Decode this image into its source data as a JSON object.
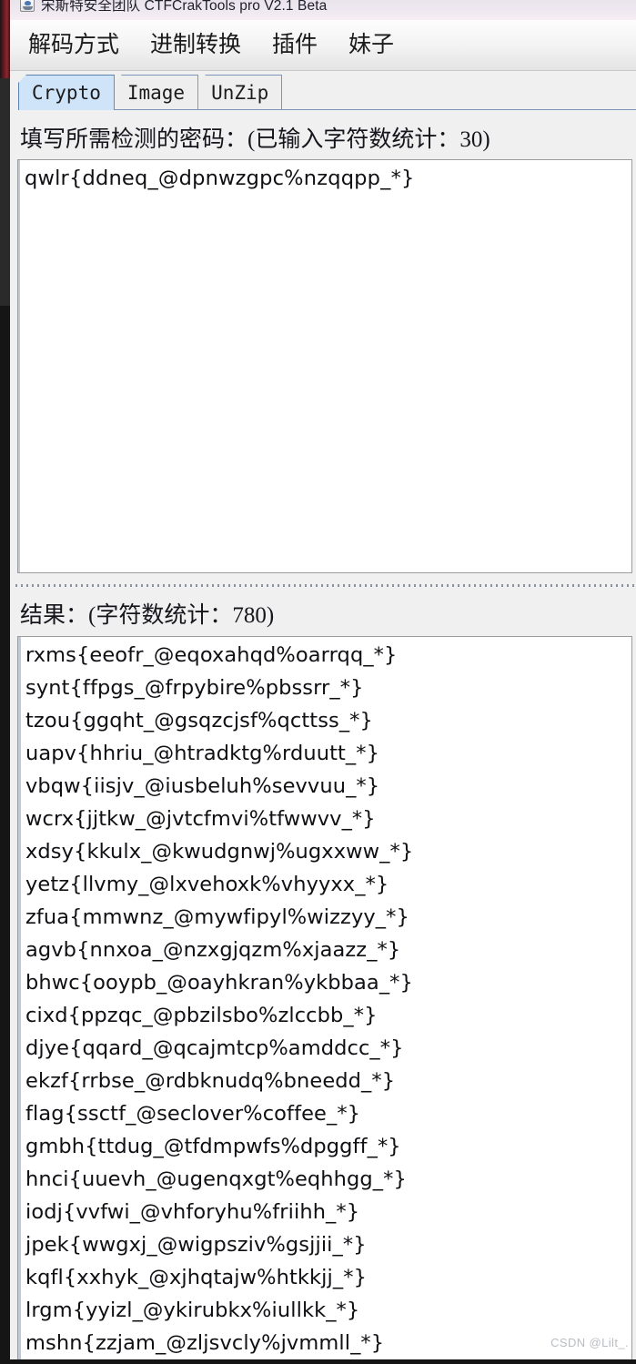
{
  "window": {
    "title": "宋斯特安全团队 CTFCrakTools pro V2.1 Beta",
    "icon": "java-app-icon"
  },
  "menubar": {
    "items": [
      {
        "label": "解码方式",
        "name": "menu-decode-method"
      },
      {
        "label": "进制转换",
        "name": "menu-base-convert"
      },
      {
        "label": "插件",
        "name": "menu-plugins"
      },
      {
        "label": "妹子",
        "name": "menu-girls"
      }
    ]
  },
  "tabs": {
    "selected": "Crypto",
    "items": [
      {
        "label": "Crypto"
      },
      {
        "label": "Image"
      },
      {
        "label": "UnZip"
      }
    ]
  },
  "input_panel": {
    "label": "填写所需检测的密码：(已输入字符数统计：30)",
    "char_count": "30",
    "value": "qwlr{ddneq_@dpnwzgpc%nzqqpp_*}"
  },
  "result_panel": {
    "label": "结果：(字符数统计：780)",
    "char_count": "780",
    "lines": [
      "rxms{eeofr_@eqoxahqd%oarrqq_*}",
      "synt{ffpgs_@frpybire%pbssrr_*}",
      "tzou{ggqht_@gsqzcjsf%qcttss_*}",
      "uapv{hhriu_@htradktg%rduutt_*}",
      "vbqw{iisjv_@iusbeluh%sevvuu_*}",
      "wcrx{jjtkw_@jvtcfmvi%tfwwvv_*}",
      "xdsy{kkulx_@kwudgnwj%ugxxww_*}",
      "yetz{llvmy_@lxvehoxk%vhyyxx_*}",
      "zfua{mmwnz_@mywfipyl%wizzyy_*}",
      "agvb{nnxoa_@nzxgjqzm%xjaazz_*}",
      "bhwc{ooypb_@oayhkran%ykbbaa_*}",
      "cixd{ppzqc_@pbzilsbo%zlccbb_*}",
      "djye{qqard_@qcajmtcp%amddcc_*}",
      "ekzf{rrbse_@rdbknudq%bneedd_*}",
      "flag{ssctf_@seclover%coffee_*}",
      "gmbh{ttdug_@tfdmpwfs%dpggff_*}",
      "hnci{uuevh_@ugenqxgt%eqhhgg_*}",
      "iodj{vvfwi_@vhforyhu%friihh_*}",
      "jpek{wwgxj_@wigpsziv%gsjjii_*}",
      "kqfl{xxhyk_@xjhqtajw%htkkjj_*}",
      "lrgm{yyizl_@ykirubkx%iullkk_*}",
      "mshn{zzjam_@zljsvcly%jvmmll_*}"
    ]
  },
  "watermark": {
    "text": "CSDN @Lilt_."
  },
  "colors": {
    "tab_selected": "#cfe3f9",
    "tab_border": "#7a96b8",
    "panel_bg": "#f0f0f0",
    "text": "#15151c",
    "field_bg": "#ffffff"
  }
}
